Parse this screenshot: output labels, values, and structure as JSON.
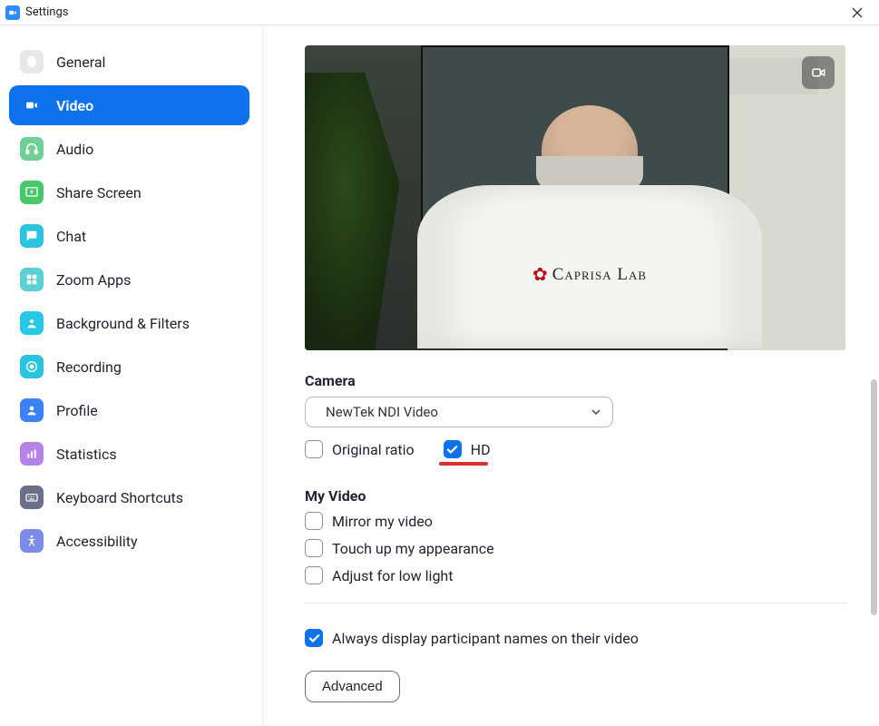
{
  "window": {
    "title": "Settings"
  },
  "sidebar": {
    "items": [
      {
        "label": "General"
      },
      {
        "label": "Video"
      },
      {
        "label": "Audio"
      },
      {
        "label": "Share Screen"
      },
      {
        "label": "Chat"
      },
      {
        "label": "Zoom Apps"
      },
      {
        "label": "Background & Filters"
      },
      {
        "label": "Recording"
      },
      {
        "label": "Profile"
      },
      {
        "label": "Statistics"
      },
      {
        "label": "Keyboard Shortcuts"
      },
      {
        "label": "Accessibility"
      }
    ],
    "active_index": 1
  },
  "preview": {
    "coat_text": "Caprisa Lab"
  },
  "camera": {
    "heading": "Camera",
    "selected": "NewTek NDI Video",
    "original_ratio": {
      "label": "Original ratio",
      "checked": false
    },
    "hd": {
      "label": "HD",
      "checked": true
    }
  },
  "my_video": {
    "heading": "My Video",
    "options": [
      {
        "label": "Mirror my video",
        "checked": false
      },
      {
        "label": "Touch up my appearance",
        "checked": false
      },
      {
        "label": "Adjust for low light",
        "checked": false
      }
    ]
  },
  "always_display": {
    "label": "Always display participant names on their video",
    "checked": true
  },
  "advanced_button": "Advanced"
}
